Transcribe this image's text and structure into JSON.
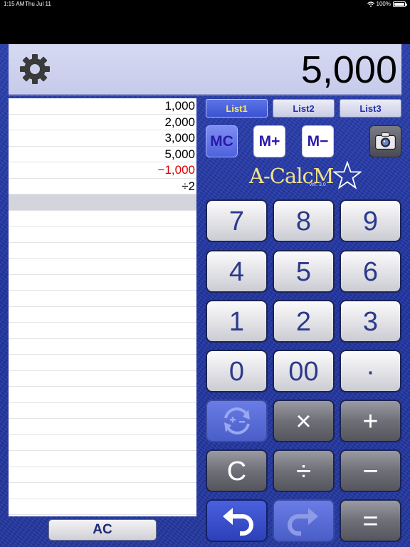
{
  "status_bar": {
    "time": "1:15 AM",
    "date": "Thu Jul 11",
    "battery": "100%",
    "battery_level": 1.0
  },
  "display": {
    "value": "5,000"
  },
  "tape": {
    "entries": [
      {
        "text": "1,000",
        "negative": false
      },
      {
        "text": "2,000",
        "negative": false
      },
      {
        "text": "3,000",
        "negative": false
      },
      {
        "text": "5,000",
        "negative": false
      },
      {
        "text": "−1,000",
        "negative": true
      },
      {
        "text": "÷2",
        "negative": false
      }
    ]
  },
  "tabs": [
    {
      "label": "List1",
      "active": true
    },
    {
      "label": "List2",
      "active": false
    },
    {
      "label": "List3",
      "active": false
    }
  ],
  "memory": {
    "mc_label": "MC",
    "mplus_label": "M+",
    "mminus_label": "M−"
  },
  "logo": {
    "text": "A-CalcM",
    "version": "Ver. 3.0"
  },
  "keys": {
    "k7": "7",
    "k8": "8",
    "k9": "9",
    "k4": "4",
    "k5": "5",
    "k6": "6",
    "k1": "1",
    "k2": "2",
    "k3": "3",
    "k0": "0",
    "k00": "00",
    "dot": "·",
    "multiply": "×",
    "plus": "+",
    "clear": "C",
    "divide": "÷",
    "minus": "−",
    "equals": "="
  },
  "ac_label": "AC",
  "colors": {
    "background_blue": "#22379f",
    "tab_active_text": "#ffe84d",
    "negative_red": "#e00000",
    "key_text": "#2c3a8a"
  },
  "icons": {
    "settings": "gear-icon",
    "camera": "camera-icon",
    "sign_toggle": "plus-minus-cycle-icon",
    "undo": "undo-arrow-icon",
    "redo": "redo-arrow-icon",
    "logo_star": "star-outline-icon",
    "wifi": "wifi-icon",
    "battery": "battery-icon"
  }
}
